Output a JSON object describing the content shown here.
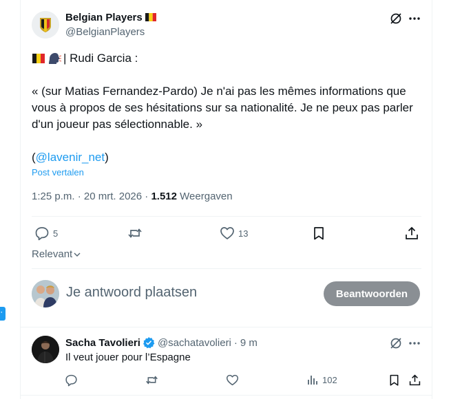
{
  "author": {
    "name": "Belgian Players",
    "handle": "@BelgianPlayers"
  },
  "tweet": {
    "intro": "| Rudi Garcia :",
    "quote_line1": "« (sur Matias Fernandez-Pardo) Je n'ai pas les mêmes informations que",
    "quote_line2": "vous à propos de ses hésitations sur sa nationalité. Je ne peux pas parler",
    "quote_line3": "d'un joueur pas sélectionnable. »",
    "source_open": "(",
    "source_link": "@lavenir_net",
    "source_close": ")",
    "translate": "Post vertalen",
    "time": "1:25 p.m.",
    "sep": "·",
    "date": "20 mrt. 2026",
    "views_count": "1.512",
    "views_label": "Weergaven"
  },
  "actions": {
    "replies": "5",
    "retweets": "",
    "likes": "13"
  },
  "sort": {
    "label": "Relevant"
  },
  "reply_box": {
    "placeholder": "Je antwoord plaatsen",
    "button": "Beantwoorden"
  },
  "reply": {
    "name": "Sacha Tavolieri",
    "handle": "@sachatavolieri",
    "sep": "·",
    "time": "9 m",
    "text": "Il veut jouer pour l’Espagne",
    "views": "102"
  },
  "colors": {
    "accent": "#1d9bf0",
    "muted": "#536471",
    "button_disabled": "#8a8f94"
  },
  "icons": [
    "grok-icon",
    "more-icon",
    "reply-icon",
    "retweet-icon",
    "like-icon",
    "bookmark-icon",
    "share-icon",
    "views-icon",
    "verified-icon",
    "belgium-flag",
    "speaking-head"
  ]
}
